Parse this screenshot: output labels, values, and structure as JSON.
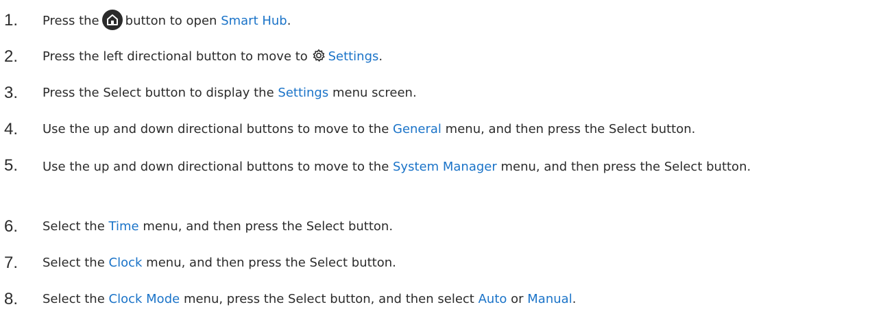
{
  "steps": [
    {
      "number": "1.",
      "before": "Press the",
      "icon": "home-icon",
      "mid": "button to open",
      "link": "Smart Hub",
      "after": "."
    },
    {
      "number": "2.",
      "before": "Press the left directional button to move to",
      "icon": "gear-icon",
      "link": "Settings",
      "after": "."
    },
    {
      "number": "3.",
      "before": "Press the Select button to display the",
      "link": "Settings",
      "after": "menu screen."
    },
    {
      "number": "4.",
      "before": "Use the up and down directional buttons to move to the",
      "link": "General",
      "after": "menu, and then press the Select button."
    },
    {
      "number": "5.",
      "before": "Use the up and down directional buttons to move to the",
      "link": "System Manager",
      "after": "menu, and then press the Select button."
    },
    {
      "number": "6.",
      "before": "Select the",
      "link": "Time",
      "after": "menu, and then press the Select button."
    },
    {
      "number": "7.",
      "before": "Select the",
      "link": "Clock",
      "after": "menu, and then press the Select button."
    },
    {
      "number": "8.",
      "before": "Select the",
      "link": "Clock Mode",
      "mid": "menu, press the Select button, and then select",
      "link2": "Auto",
      "or": "or",
      "link3": "Manual",
      "after": "."
    }
  ],
  "colors": {
    "text": "#2b2b2b",
    "link": "#1a73c8"
  }
}
